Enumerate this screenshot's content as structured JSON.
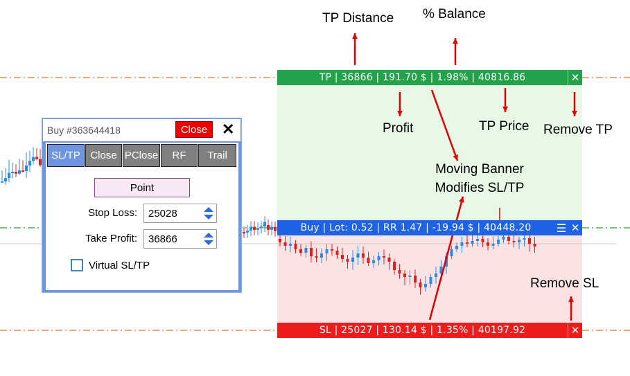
{
  "annotations": {
    "tp_distance": "TP Distance",
    "pct_balance": "% Balance",
    "profit": "Profit",
    "tp_price": "TP Price",
    "remove_tp": "Remove TP",
    "moving_banner_line1": "Moving Banner",
    "moving_banner_line2": "Modifies SL/TP",
    "remove_sl": "Remove SL"
  },
  "bands": {
    "tp": {
      "text": "TP | 36866 | 191.70 $ | 1.98% | 40816.86",
      "close": "✕",
      "color": "#22a24a"
    },
    "buy": {
      "text": "Buy | Lot: 0.52 | RR 1.47 | -19.94 $ | 40448.20",
      "menu": "☰",
      "close": "✕",
      "color": "#1e63e6"
    },
    "sl": {
      "text": "SL | 25027 | 130.14 $ | 1.35% | 40197.92",
      "close": "✕",
      "color": "#ee1c1c"
    }
  },
  "panel": {
    "title": "Buy #363644418",
    "close_label": "Close",
    "x_label": "✕",
    "tabs": [
      {
        "label": "SL/TP",
        "active": true
      },
      {
        "label": "Close",
        "active": false
      },
      {
        "label": "PClose",
        "active": false
      },
      {
        "label": "RF",
        "active": false
      },
      {
        "label": "Trail",
        "active": false
      }
    ],
    "point_label": "Point",
    "stop_loss_label": "Stop Loss:",
    "stop_loss_value": "25028",
    "take_profit_label": "Take Profit:",
    "take_profit_value": "36866",
    "virtual_label": "Virtual SL/TP",
    "virtual_checked": false
  },
  "colors": {
    "tp_zone": "#e8f8e6",
    "sl_zone": "#fbe3e3",
    "tp_line": "#f07030",
    "entry_line": "#2ca02c",
    "sl_line": "#f07030",
    "arrow": "#e00000",
    "candle_up": "#2a8be8",
    "candle_down": "#e02020"
  }
}
